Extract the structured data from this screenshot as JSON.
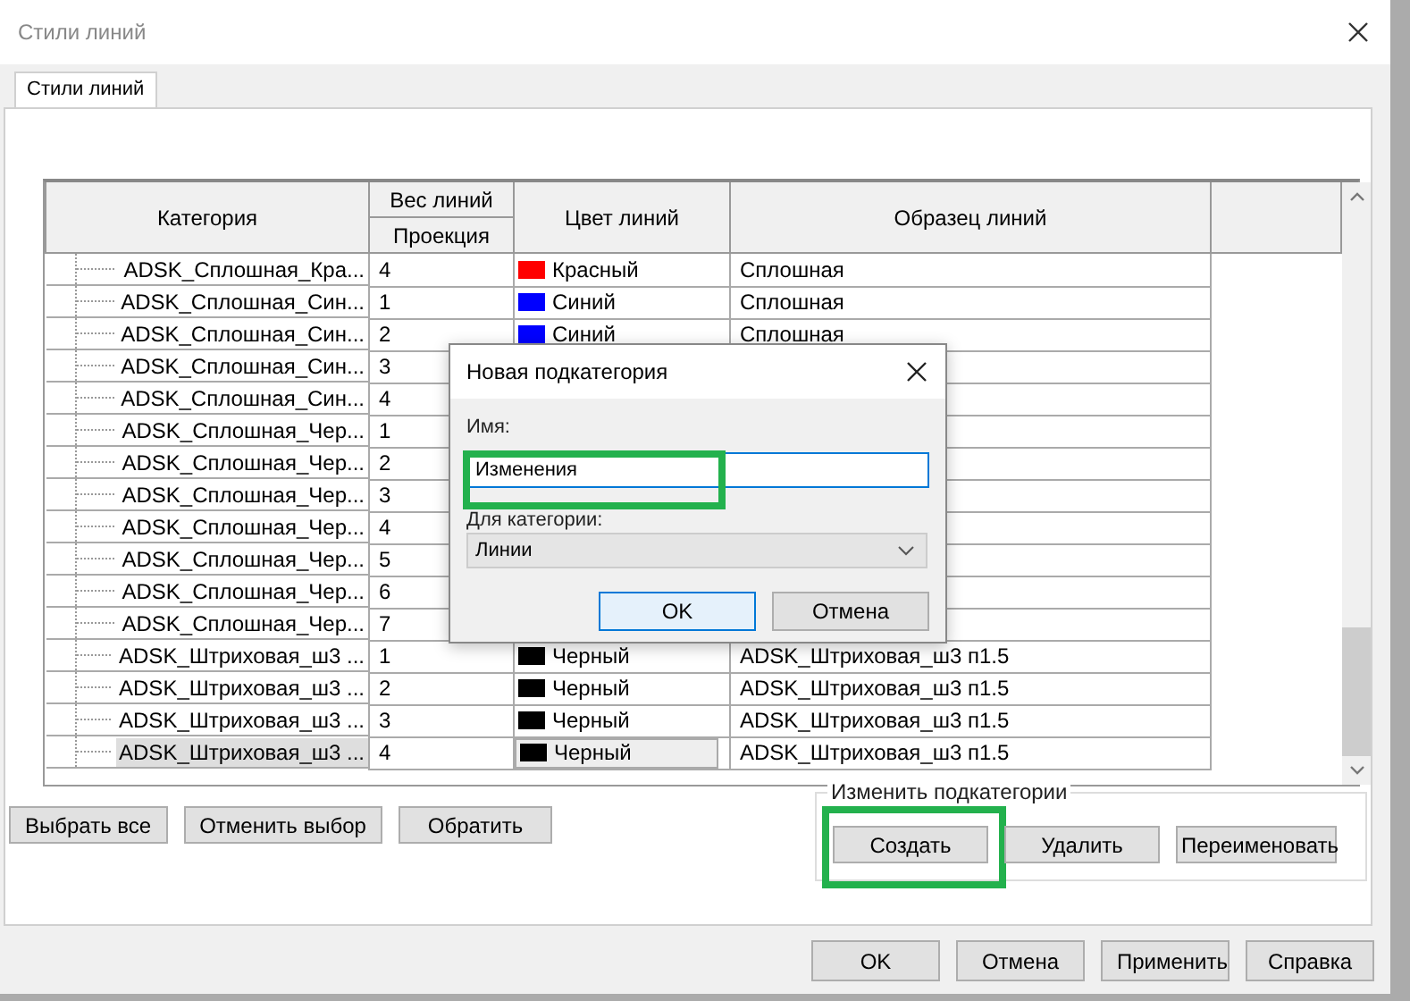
{
  "window": {
    "title": "Стили линий"
  },
  "tabs": [
    {
      "label": "Стили линий",
      "selected": true
    }
  ],
  "table": {
    "columns": [
      {
        "label": "Категория"
      },
      {
        "group": "Вес линий",
        "label": "Проекция"
      },
      {
        "label": "Цвет линий"
      },
      {
        "label": "Образец линий"
      }
    ],
    "rows": [
      {
        "category": "ADSK_Сплошная_Кра...",
        "weight": "4",
        "color_name": "Красный",
        "color": "#ff0000",
        "pattern": "Сплошная",
        "selected": false
      },
      {
        "category": "ADSK_Сплошная_Син...",
        "weight": "1",
        "color_name": "Синий",
        "color": "#0000ff",
        "pattern": "Сплошная",
        "selected": false
      },
      {
        "category": "ADSK_Сплошная_Син...",
        "weight": "2",
        "color_name": "Синий",
        "color": "#0000ff",
        "pattern": "Сплошная",
        "selected": false
      },
      {
        "category": "ADSK_Сплошная_Син...",
        "weight": "3",
        "selected": false
      },
      {
        "category": "ADSK_Сплошная_Син...",
        "weight": "4",
        "selected": false
      },
      {
        "category": "ADSK_Сплошная_Чер...",
        "weight": "1",
        "selected": false
      },
      {
        "category": "ADSK_Сплошная_Чер...",
        "weight": "2",
        "selected": false
      },
      {
        "category": "ADSK_Сплошная_Чер...",
        "weight": "3",
        "selected": false
      },
      {
        "category": "ADSK_Сплошная_Чер...",
        "weight": "4",
        "selected": false
      },
      {
        "category": "ADSK_Сплошная_Чер...",
        "weight": "5",
        "selected": false
      },
      {
        "category": "ADSK_Сплошная_Чер...",
        "weight": "6",
        "selected": false
      },
      {
        "category": "ADSK_Сплошная_Чер...",
        "weight": "7",
        "selected": false
      },
      {
        "category": "ADSK_Штриховая_ш3 ...",
        "weight": "1",
        "color_name": "Черный",
        "color": "#000000",
        "pattern": "ADSK_Штриховая_ш3 п1.5",
        "selected": false
      },
      {
        "category": "ADSK_Штриховая_ш3 ...",
        "weight": "2",
        "color_name": "Черный",
        "color": "#000000",
        "pattern": "ADSK_Штриховая_ш3 п1.5",
        "selected": false
      },
      {
        "category": "ADSK_Штриховая_ш3 ...",
        "weight": "3",
        "color_name": "Черный",
        "color": "#000000",
        "pattern": "ADSK_Штриховая_ш3 п1.5",
        "selected": false
      },
      {
        "category": "ADSK_Штриховая_ш3 ...",
        "weight": "4",
        "color_name": "Черный",
        "color": "#000000",
        "pattern": "ADSK_Штриховая_ш3 п1.5",
        "selected": true
      }
    ]
  },
  "selection_buttons": [
    "Выбрать все",
    "Отменить выбор",
    "Обратить"
  ],
  "subcategory_group": {
    "title": "Изменить подкатегории",
    "buttons": [
      {
        "label": "Создать",
        "highlighted": true
      },
      {
        "label": "Удалить",
        "highlighted": false
      },
      {
        "label": "Переименовать",
        "highlighted": false
      }
    ]
  },
  "footer_buttons": [
    "OK",
    "Отмена",
    "Применить",
    "Справка"
  ],
  "dialog": {
    "title": "Новая подкатегория",
    "name_label": "Имя:",
    "name_value": "Изменения",
    "name_highlighted": true,
    "category_label": "Для категории:",
    "category_value": "Линии",
    "buttons": [
      {
        "label": "OK",
        "default": true
      },
      {
        "label": "Отмена",
        "default": false
      }
    ]
  }
}
